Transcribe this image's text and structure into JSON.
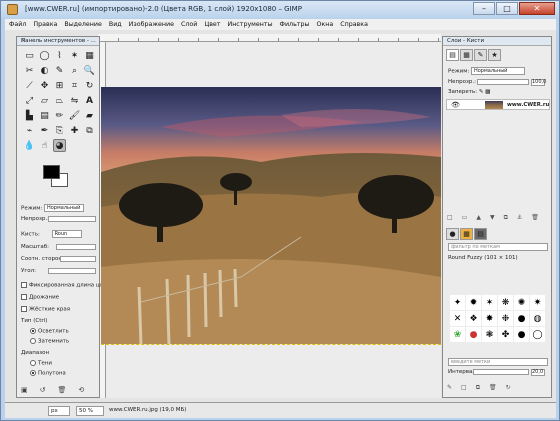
{
  "window": {
    "title": "[www.CWER.ru] (импортировано)-2.0 (Цвета RGB, 1 слой) 1920x1080 – GIMP"
  },
  "menu": [
    "Файл",
    "Правка",
    "Выделение",
    "Вид",
    "Изображение",
    "Слой",
    "Цвет",
    "Инструменты",
    "Фильтры",
    "Окна",
    "Справка"
  ],
  "toolbox": {
    "title": "Панель инструментов - ...",
    "tools": [
      "rect-select",
      "ellipse-select",
      "free-select",
      "fuzzy-select",
      "select-by-color",
      "scissors",
      "foreground-select",
      "paths",
      "color-picker",
      "zoom",
      "measure",
      "move",
      "align",
      "crop",
      "rotate",
      "scale",
      "shear",
      "perspective",
      "flip",
      "text",
      "bucket-fill",
      "blend",
      "pencil",
      "paintbrush",
      "eraser",
      "airbrush",
      "ink",
      "clone",
      "heal",
      "perspective-clone",
      "blur",
      "smudge",
      "dodge-burn"
    ],
    "options": {
      "mode_label": "Режим:",
      "mode_value": "Нормальный",
      "opacity_label": "Непрозр.:",
      "brush_label": "Кисть:",
      "brush_value": "Roun",
      "scale_label": "Масштаб:",
      "aspect_label": "Соотн. сторон:",
      "angle_label": "Угол:",
      "fixed_length": "Фиксированная длина ш",
      "jitter": "Дрожание",
      "hard_edge": "Жёсткие края",
      "type_label": "Тип (Ctrl)",
      "type_lighten": "Осветлить",
      "type_darken": "Затемнить",
      "range_label": "Диапазон",
      "range_shadows": "Тени",
      "range_midtones": "Полутона"
    }
  },
  "layers_panel": {
    "title": "Слои - Кисти",
    "mode_label": "Режим:",
    "mode_value": "Нормальный",
    "opacity_label": "Непрозр.:",
    "opacity_value": "100,0",
    "lock_label": "Запереть:",
    "layer_name": "www.CWER.ru",
    "filter_placeholder": "фильтр по меткам",
    "brush_name": "Round Fuzzy (101 × 101)",
    "tag_placeholder": "введите метки",
    "spacing_label": "Интервал:",
    "spacing_value": "20,0"
  },
  "status": {
    "unit": "px",
    "zoom": "50 %",
    "info": "www.CWER.ru.jpg (19,0 МБ)"
  },
  "colors": {
    "foreground": "#000000",
    "background": "#ffffff"
  }
}
